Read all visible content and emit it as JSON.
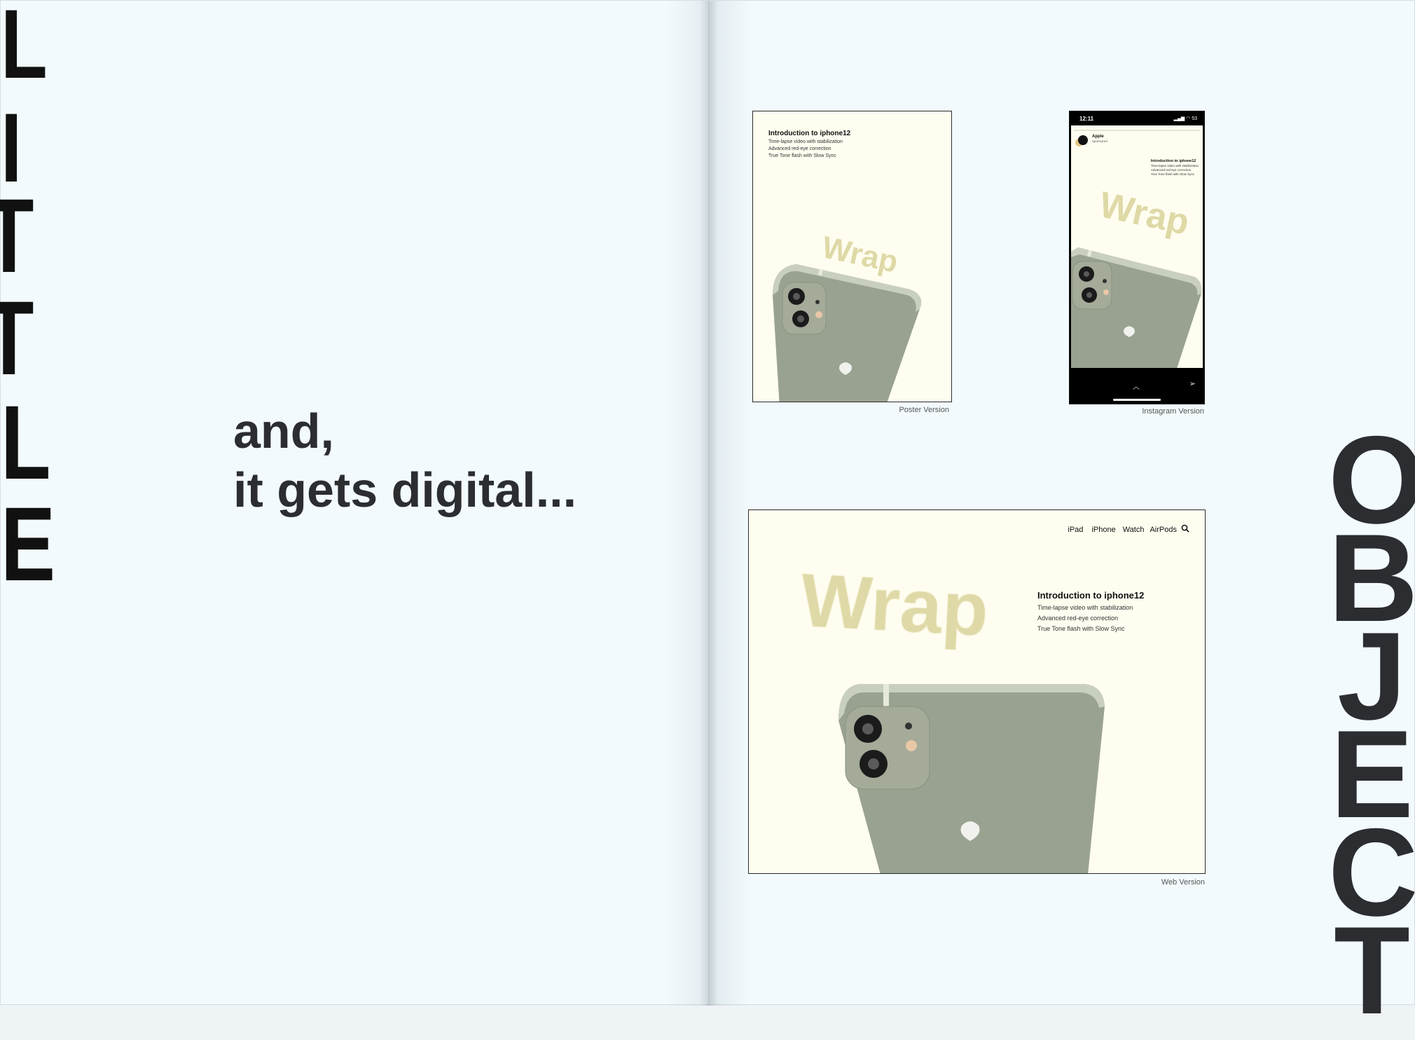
{
  "left_page": {
    "vertical_word_letters": [
      "L",
      "I",
      "T",
      "T",
      "L",
      "E"
    ],
    "headline_lines": [
      "and,",
      "it gets digital..."
    ]
  },
  "right_page": {
    "vertical_word_letters": [
      "O",
      "B",
      "J",
      "E",
      "C",
      "T"
    ],
    "poster": {
      "intro_title": "Introduction to iphone12",
      "intro_lines": [
        "Time-lapse video with stabilization",
        "Advanced red-eye correction",
        "True Tone flash with Slow Sync"
      ],
      "wrap_word": "Wrap",
      "caption": "Poster Version"
    },
    "instagram": {
      "time": "12:11",
      "status_icons": "▂▄▆ ◠ 53",
      "account_name": "Apple",
      "account_sub": "Sponsored",
      "intro_title": "Introduction to iphone12",
      "intro_lines": [
        "Time-lapse video with stabilization",
        "Advanced red-eye correction",
        "True Tone flash with Slow Sync"
      ],
      "wrap_word": "Wrap",
      "chevron_icon": "chevron-up-icon",
      "send_icon": "send-icon",
      "caption": "Instagram Version"
    },
    "web": {
      "nav": [
        "iPad",
        "iPhone",
        "Watch",
        "AirPods"
      ],
      "search_icon": "search-icon",
      "wrap_word": "Wrap",
      "intro_title": "Introduction to iphone12",
      "intro_lines": [
        "Time-lapse video with stabilization",
        "Advanced red-eye correction",
        "True Tone flash with Slow Sync"
      ],
      "caption": "Web Version"
    }
  },
  "colors": {
    "page": "#f2fafd",
    "card": "#fffdef",
    "wrap_text": "#dcd6a0",
    "phone_body": "#9aa392",
    "ink": "#2b2d31"
  }
}
